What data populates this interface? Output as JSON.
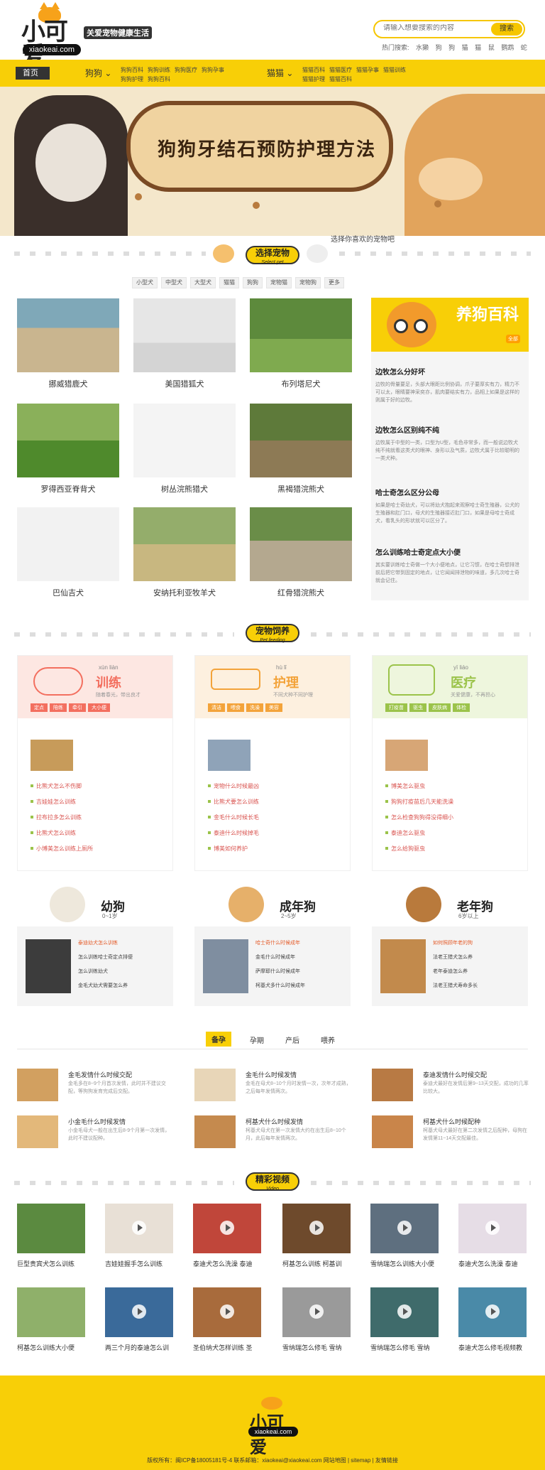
{
  "header": {
    "logo_text": "小可爱",
    "domain": "xiaokeai.com",
    "slogan": "关爱宠物健康生活",
    "search_placeholder": "请输入想要搜索的内容",
    "search_button": "搜索",
    "hot_label": "热门搜索:",
    "hot_words": [
      "水獭",
      "狗",
      "狗",
      "猫",
      "猫",
      "鼠",
      "鹦鹉",
      "蛇"
    ]
  },
  "nav": {
    "home": "首页",
    "cat1": "狗狗",
    "cat1_sub": [
      "狗狗百科",
      "狗狗训练",
      "狗狗医疗",
      "狗狗孕事",
      "狗狗护理",
      "狗狗百科"
    ],
    "cat2": "猫猫",
    "cat2_sub": [
      "猫猫百科",
      "猫猫医疗",
      "猫猫孕事",
      "猫猫训练",
      "猫猫护理",
      "猫猫百科"
    ]
  },
  "banner": {
    "title": "狗狗牙结石预防护理方法"
  },
  "select_pet": {
    "title": "选择宠物",
    "subtitle": "Select pet",
    "bubble": "选择你喜欢的宠物吧",
    "tabs": [
      "小型犬",
      "中型犬",
      "大型犬",
      "猫猫",
      "狗狗",
      "宠物猫",
      "宠物狗",
      "更多"
    ],
    "dogs": [
      {
        "name": "挪威猎鹿犬"
      },
      {
        "name": "美国猎狐犬"
      },
      {
        "name": "布列塔尼犬"
      },
      {
        "name": "罗得西亚脊背犬"
      },
      {
        "name": "树丛浣熊猎犬"
      },
      {
        "name": "黑褐猎浣熊犬"
      },
      {
        "name": "巴仙吉犬"
      },
      {
        "name": "安纳托利亚牧羊犬"
      },
      {
        "name": "红骨猎浣熊犬"
      }
    ]
  },
  "encyclopedia": {
    "title": "养狗百科",
    "badge": "全部",
    "items": [
      {
        "title": "边牧怎么分好坏",
        "desc": "边牧的骨量要足，头部大眼距比例协调，爪子要厚实有力，精力不可以太，眼睛要神采奕亦，肌肉要结实有力，品相上如果是这样的则属于好的边牧。"
      },
      {
        "title": "边牧怎么区别纯不纯",
        "desc": "边牧属于中型的一类，口型为U型，毛色非常多，而一般说边牧犬纯不纯就看这类犬的眼神、身形以及气质，边牧犬属于比较聪明的一类犬种。"
      },
      {
        "title": "哈士奇怎么区分公母",
        "desc": "如果是哈士奇幼犬，可以将幼犬抱起来观察哈士奇生殖器，公犬的生殖器和肛门口，母犬的生殖器接近肛门口，如果是母哈士奇成犬，看乳头的形状就可以区分了。"
      },
      {
        "title": "怎么训练哈士奇定点大小便",
        "desc": "其实要训练哈士奇做一个大小便地点，让它习惯，在哈士奇想排泄前后把它带到固定的地点，让它闻闻排泄物的味道，多几次哈士奇就会记住。"
      }
    ]
  },
  "feeding": {
    "title": "宠物饲养",
    "subtitle": "Pet feeding",
    "cards": [
      {
        "name": "训练",
        "pinyin": "xùn liàn",
        "sub": "随着春光，带出良才",
        "color": "#f36f5f",
        "bg": "#fde7e2",
        "chips": [
          "定点",
          "陪练",
          "牵引",
          "大小便"
        ],
        "items": [
          "比熊犬怎么不伤脚",
          "吉娃娃怎么训练",
          "拉布拉多怎么训练",
          "比熊犬怎么训练",
          "小博美怎么训练上厕所"
        ]
      },
      {
        "name": "护理",
        "pinyin": "hù lǐ",
        "sub": "不同犬种不同护理",
        "color": "#f3a33a",
        "bg": "#fdf0df",
        "chips": [
          "清洁",
          "喂食",
          "洗澡",
          "美容"
        ],
        "items": [
          "宠物什么时候最凶",
          "比熊犬要怎么训练",
          "金毛什么时候长毛",
          "泰迪什么时候掉毛",
          "博美如何养护"
        ]
      },
      {
        "name": "医疗",
        "pinyin": "yī liáo",
        "sub": "关爱健康，不再担心",
        "color": "#9bc34a",
        "bg": "#eef6dd",
        "chips": [
          "打疫苗",
          "驱虫",
          "皮肤病",
          "体检"
        ],
        "items": [
          "博美怎么驱虫",
          "狗狗打疫苗后几天能洗澡",
          "怎么检查狗狗得没得细小",
          "泰迪怎么驱虫",
          "怎么给狗驱虫"
        ]
      }
    ]
  },
  "ages": [
    {
      "name": "幼狗",
      "range": "0~1岁",
      "items": [
        "泰迪幼犬怎么训练",
        "怎么训练哈士奇定点排便",
        "怎么训练幼犬",
        "金毛犬幼犬需要怎么养"
      ]
    },
    {
      "name": "成年狗",
      "range": "2~5岁",
      "items": [
        "哈士奇什么时候成年",
        "金毛什么时候成年",
        "萨摩耶什么时候成年",
        "柯基犬多什么时候成年"
      ]
    },
    {
      "name": "老年狗",
      "range": "6岁以上",
      "items": [
        "如何照顾年老的狗",
        "法老王猎犬怎么养",
        "老年泰迪怎么养",
        "法老王猎犬寿命多长"
      ]
    }
  ],
  "stages": {
    "tabs": [
      "备孕",
      "孕期",
      "产后",
      "喂养"
    ],
    "articles": [
      {
        "title": "金毛发情什么时候交配",
        "desc": "金毛多在8~9个月首次发情，此时并不建议交配，等狗狗发育完成后交配。"
      },
      {
        "title": "金毛什么时候发情",
        "desc": "金毛在母犬8~10个月时发情一次，次年才成熟，之后每年发情两次。"
      },
      {
        "title": "泰迪发情什么时候交配",
        "desc": "泰迪犬最好在发情后第9~13天交配，成功的几率比较大。"
      },
      {
        "title": "小金毛什么时候发情",
        "desc": "小金毛母犬一般在出生后8-9个月第一次发情，此时不建议配种。"
      },
      {
        "title": "柯基犬什么时候发情",
        "desc": "柯基犬母犬在第一次发情大约在出生后8~10个月，此后每年发情两次。"
      },
      {
        "title": "柯基犬什么时候配种",
        "desc": "柯基犬母犬最好在第二次发情之后配种，母狗在发情第11~14天交配最佳。"
      }
    ]
  },
  "videos": {
    "title": "精彩视频",
    "subtitle": "Video",
    "items": [
      {
        "title": "巨型贵宾犬怎么训练"
      },
      {
        "title": "吉娃娃握手怎么训练"
      },
      {
        "title": "泰迪犬怎么洗澡 泰迪"
      },
      {
        "title": "柯基怎么训练 柯基训"
      },
      {
        "title": "雪纳瑞怎么训练大小便"
      },
      {
        "title": "泰迪犬怎么洗澡 泰迪"
      },
      {
        "title": "柯基怎么训练大小便"
      },
      {
        "title": "两三个月的泰迪怎么训"
      },
      {
        "title": "圣伯纳犬怎样训练 圣"
      },
      {
        "title": "雪纳瑞怎么修毛 雪纳"
      },
      {
        "title": "雪纳瑞怎么修毛 雪纳"
      },
      {
        "title": "泰迪犬怎么修毛视频教"
      }
    ]
  },
  "footer": {
    "logo_text": "小可爱",
    "domain": "xiaokeai.com",
    "copy": "版权所有：闽ICP备18005181号-4    联系邮箱：xiaokeai@xiaokeai.com    网站地图 | sitemap | 友情链接"
  }
}
